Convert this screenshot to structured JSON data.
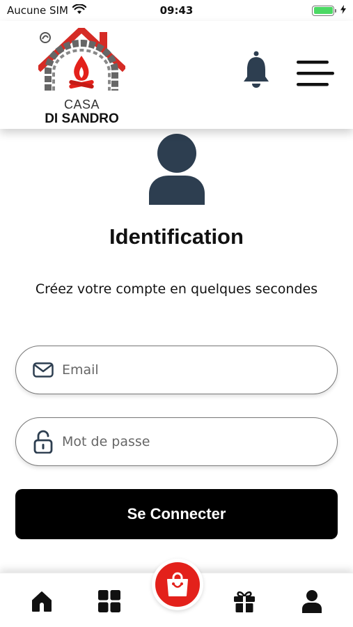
{
  "status_bar": {
    "carrier": "Aucune SIM",
    "time": "09:43"
  },
  "header": {
    "logo_line1": "CASA",
    "logo_line2": "DI SANDRO"
  },
  "login": {
    "title": "Identification",
    "subtitle": "Créez votre compte en quelques secondes",
    "email_placeholder": "Email",
    "password_placeholder": "Mot de passe",
    "submit_label": "Se Connecter"
  },
  "tabs": [
    {
      "icon": "home-icon"
    },
    {
      "icon": "grid-icon"
    },
    {
      "icon": "shopping-bag-icon"
    },
    {
      "icon": "gift-icon"
    },
    {
      "icon": "user-icon"
    }
  ],
  "colors": {
    "brand_red": "#e3211b",
    "icon_navy": "#2d3e50",
    "battery_green": "#4cd964"
  }
}
